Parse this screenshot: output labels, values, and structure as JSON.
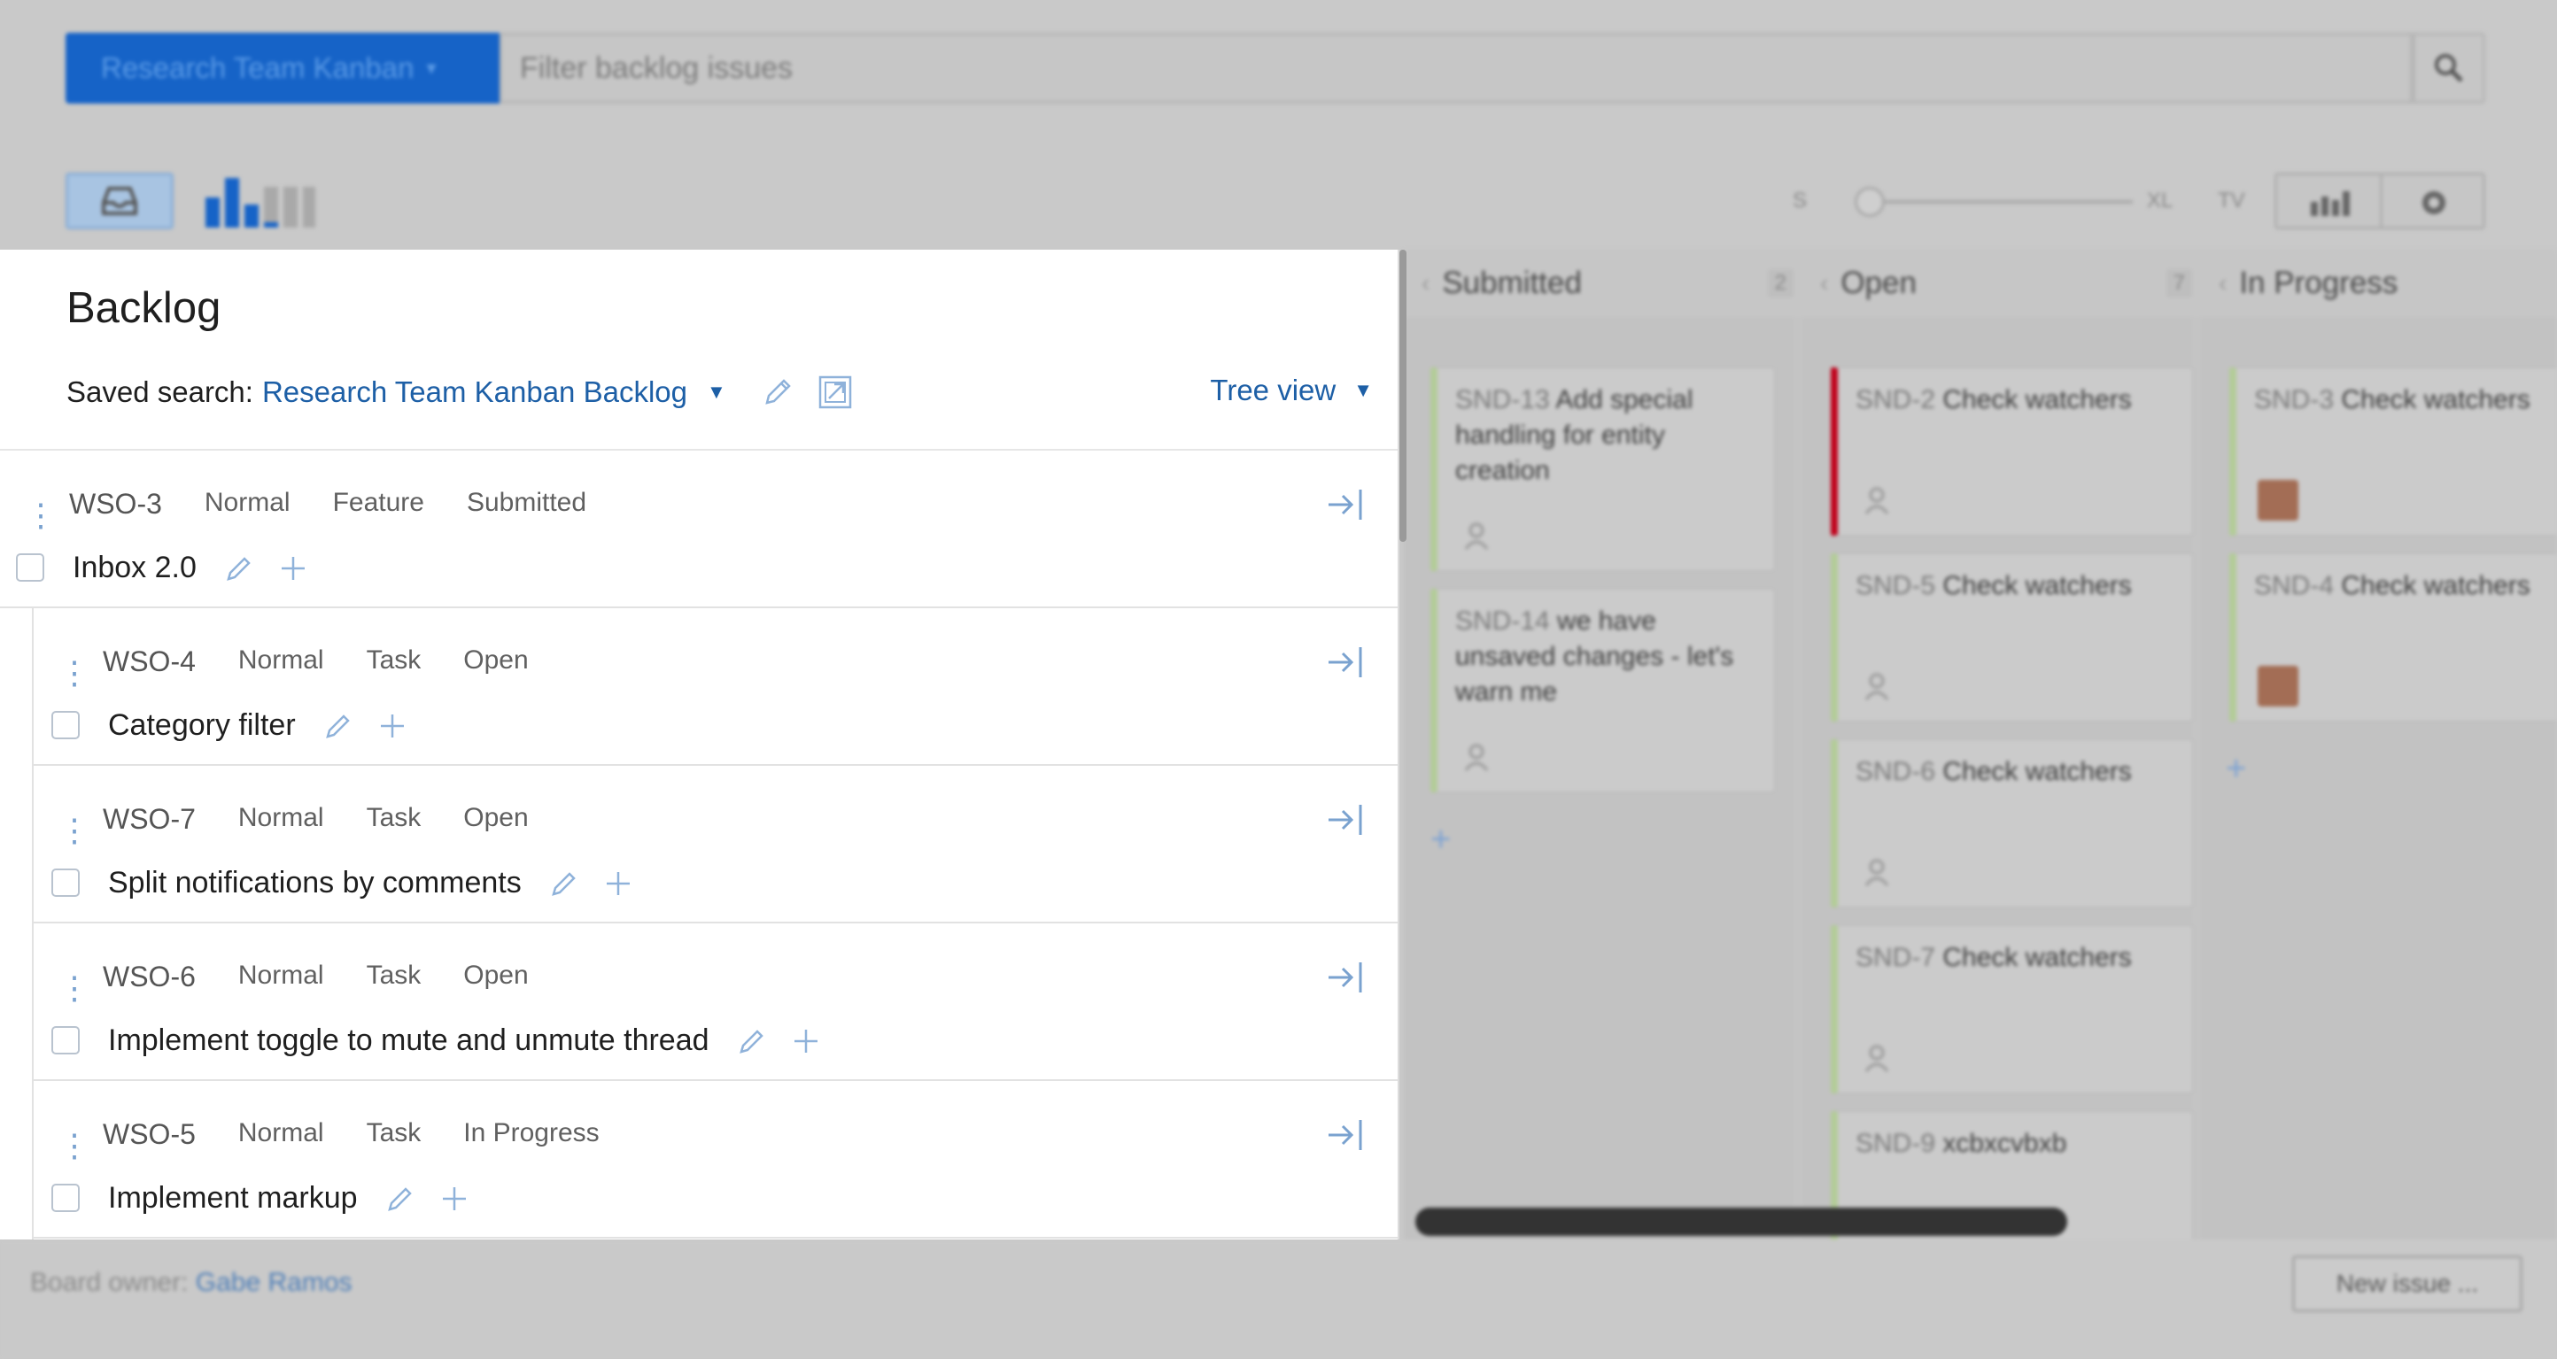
{
  "topbar": {
    "board_name": "Research Team Kanban",
    "search_placeholder": "Filter backlog issues"
  },
  "toolbar": {
    "size_small": "S",
    "size_large": "XL",
    "size_tv": "TV"
  },
  "backlog": {
    "title": "Backlog",
    "saved_search_label": "Saved search:",
    "saved_search_name": "Research Team Kanban Backlog",
    "view_mode": "Tree view",
    "issues": [
      {
        "key": "WSO-3",
        "priority": "Normal",
        "type": "Feature",
        "state": "Submitted",
        "summary": "Inbox 2.0"
      },
      {
        "key": "WSO-4",
        "priority": "Normal",
        "type": "Task",
        "state": "Open",
        "summary": "Category filter"
      },
      {
        "key": "WSO-7",
        "priority": "Normal",
        "type": "Task",
        "state": "Open",
        "summary": "Split notifications by comments"
      },
      {
        "key": "WSO-6",
        "priority": "Normal",
        "type": "Task",
        "state": "Open",
        "summary": "Implement toggle to mute and unmute thread"
      },
      {
        "key": "WSO-5",
        "priority": "Normal",
        "type": "Task",
        "state": "In Progress",
        "summary": "Implement markup"
      }
    ]
  },
  "board": {
    "columns": [
      {
        "name": "Submitted",
        "count": "2"
      },
      {
        "name": "Open",
        "count": "7"
      },
      {
        "name": "In Progress",
        "count": ""
      }
    ],
    "cards": {
      "submitted": [
        {
          "id": "SND-13",
          "title": "Add special handling for entity creation"
        },
        {
          "id": "SND-14",
          "title": "we have unsaved changes - let's warn me"
        }
      ],
      "open": [
        {
          "id": "SND-2",
          "title": "Check watchers"
        },
        {
          "id": "SND-5",
          "title": "Check watchers"
        },
        {
          "id": "SND-6",
          "title": "Check watchers"
        },
        {
          "id": "SND-7",
          "title": "Check watchers"
        },
        {
          "id": "SND-9",
          "title": "xcbxcvbxb"
        }
      ],
      "in_progress": [
        {
          "id": "SND-3",
          "title": "Check watchers"
        },
        {
          "id": "SND-4",
          "title": "Check watchers"
        }
      ]
    }
  },
  "footer": {
    "owner_label": "Board owner:",
    "owner_name": "Gabe Ramos",
    "new_issue_label": "New issue ..."
  },
  "colors": {
    "accent": "#1d5fa6",
    "primary_button": "#1663c7",
    "urgent": "#c0001a",
    "card_stripe": "#b3cc98"
  }
}
